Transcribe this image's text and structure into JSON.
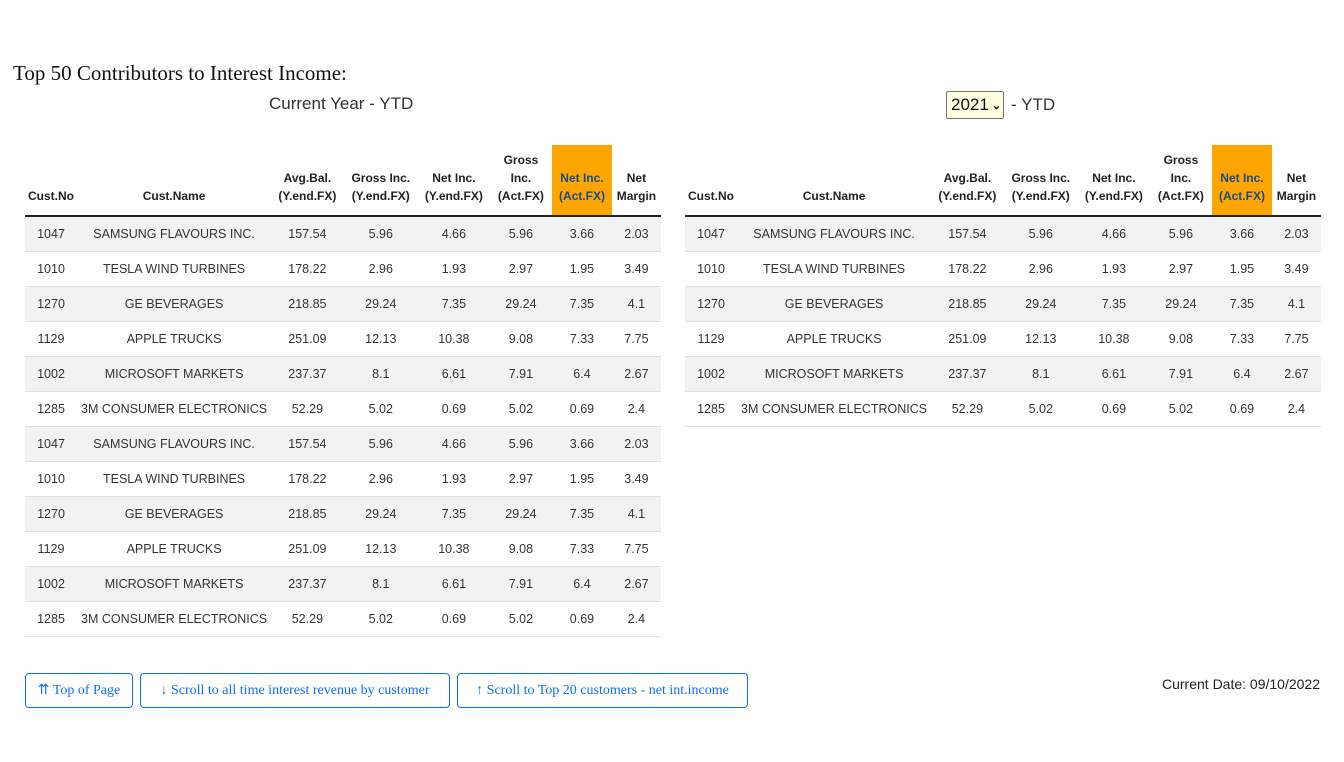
{
  "page": {
    "title": "Top 50 Contributors to Interest Income:",
    "left_subtitle": "Current Year - YTD",
    "year_select_value": "2021",
    "right_subtitle": "- YTD",
    "current_date": "Current Date: 09/10/2022"
  },
  "columns": [
    "Cust.No",
    "Cust.Name",
    "Avg.Bal. (Y.end.FX)",
    "Gross Inc. (Y.end.FX)",
    "Net Inc. (Y.end.FX)",
    "Gross Inc. (Act.FX)",
    "Net Inc. (Act.FX)",
    "Net Margin"
  ],
  "left_rows": [
    [
      "1047",
      "SAMSUNG FLAVOURS INC.",
      "157.54",
      "5.96",
      "4.66",
      "5.96",
      "3.66",
      "2.03"
    ],
    [
      "1010",
      "TESLA WIND TURBINES",
      "178.22",
      "2.96",
      "1.93",
      "2.97",
      "1.95",
      "3.49"
    ],
    [
      "1270",
      "GE BEVERAGES",
      "218.85",
      "29.24",
      "7.35",
      "29.24",
      "7.35",
      "4.1"
    ],
    [
      "1129",
      "APPLE TRUCKS",
      "251.09",
      "12.13",
      "10.38",
      "9.08",
      "7.33",
      "7.75"
    ],
    [
      "1002",
      "MICROSOFT MARKETS",
      "237.37",
      "8.1",
      "6.61",
      "7.91",
      "6.4",
      "2.67"
    ],
    [
      "1285",
      "3M CONSUMER ELECTRONICS",
      "52.29",
      "5.02",
      "0.69",
      "5.02",
      "0.69",
      "2.4"
    ],
    [
      "1047",
      "SAMSUNG FLAVOURS INC.",
      "157.54",
      "5.96",
      "4.66",
      "5.96",
      "3.66",
      "2.03"
    ],
    [
      "1010",
      "TESLA WIND TURBINES",
      "178.22",
      "2.96",
      "1.93",
      "2.97",
      "1.95",
      "3.49"
    ],
    [
      "1270",
      "GE BEVERAGES",
      "218.85",
      "29.24",
      "7.35",
      "29.24",
      "7.35",
      "4.1"
    ],
    [
      "1129",
      "APPLE TRUCKS",
      "251.09",
      "12.13",
      "10.38",
      "9.08",
      "7.33",
      "7.75"
    ],
    [
      "1002",
      "MICROSOFT MARKETS",
      "237.37",
      "8.1",
      "6.61",
      "7.91",
      "6.4",
      "2.67"
    ],
    [
      "1285",
      "3M CONSUMER ELECTRONICS",
      "52.29",
      "5.02",
      "0.69",
      "5.02",
      "0.69",
      "2.4"
    ]
  ],
  "right_rows": [
    [
      "1047",
      "SAMSUNG FLAVOURS INC.",
      "157.54",
      "5.96",
      "4.66",
      "5.96",
      "3.66",
      "2.03"
    ],
    [
      "1010",
      "TESLA WIND TURBINES",
      "178.22",
      "2.96",
      "1.93",
      "2.97",
      "1.95",
      "3.49"
    ],
    [
      "1270",
      "GE BEVERAGES",
      "218.85",
      "29.24",
      "7.35",
      "29.24",
      "7.35",
      "4.1"
    ],
    [
      "1129",
      "APPLE TRUCKS",
      "251.09",
      "12.13",
      "10.38",
      "9.08",
      "7.33",
      "7.75"
    ],
    [
      "1002",
      "MICROSOFT MARKETS",
      "237.37",
      "8.1",
      "6.61",
      "7.91",
      "6.4",
      "2.67"
    ],
    [
      "1285",
      "3M CONSUMER ELECTRONICS",
      "52.29",
      "5.02",
      "0.69",
      "5.02",
      "0.69",
      "2.4"
    ]
  ],
  "buttons": {
    "top_of_page": "⇈ Top of Page",
    "scroll_all": "↓ Scroll to all time interest revenue by customer",
    "scroll_top20": "↑ Scroll to Top 20 customers - net int.income"
  },
  "colors": {
    "highlight_column": "#ffa500",
    "button_accent": "#0d6efd",
    "select_bg": "#ffffe0"
  }
}
